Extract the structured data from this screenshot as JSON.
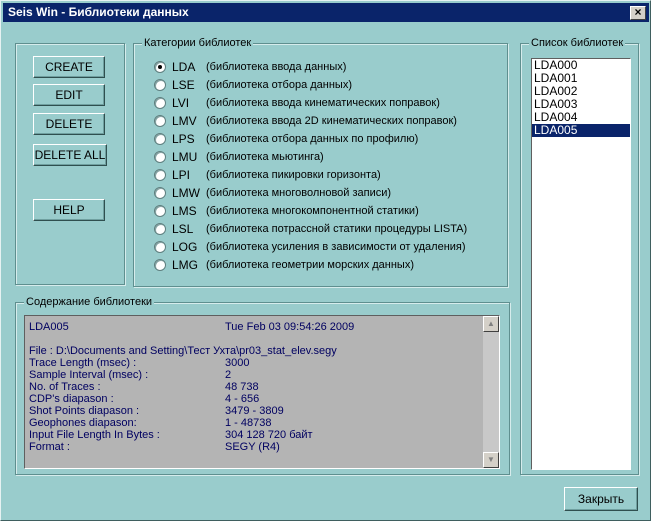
{
  "window": {
    "title": "Seis Win - Библиотеки данных",
    "close_glyph": "×"
  },
  "actions": {
    "create": "CREATE",
    "edit": "EDIT",
    "delete": "DELETE",
    "delete_all": "DELETE ALL",
    "help": "HELP"
  },
  "categories": {
    "title": "Категории библиотек",
    "selected": "LDA",
    "items": [
      {
        "code": "LDA",
        "desc": "(библиотека ввода данных)",
        "checked": true
      },
      {
        "code": "LSE",
        "desc": "(библиотека отбора данных)",
        "checked": false
      },
      {
        "code": "LVI",
        "desc": "(библиотека ввода кинематических поправок)",
        "checked": false
      },
      {
        "code": "LMV",
        "desc": "(библиотека ввода 2D кинематических поправок)",
        "checked": false
      },
      {
        "code": "LPS",
        "desc": "(библиотека отбора данных по профилю)",
        "checked": false
      },
      {
        "code": "LMU",
        "desc": "(библиотека мьютинга)",
        "checked": false
      },
      {
        "code": "LPI",
        "desc": "(библиотека пикировки горизонта)",
        "checked": false
      },
      {
        "code": "LMW",
        "desc": "(библиотека многоволновой записи)",
        "checked": false
      },
      {
        "code": "LMS",
        "desc": "(библиотека многокомпонентной статики)",
        "checked": false
      },
      {
        "code": "LSL",
        "desc": "(библиотека потрассной статики процедуры LISTA)",
        "checked": false
      },
      {
        "code": "LOG",
        "desc": "(библиотека усиления в зависимости от удаления)",
        "checked": false
      },
      {
        "code": "LMG",
        "desc": "(библиотека геометрии морских данных)",
        "checked": false
      }
    ]
  },
  "library_list": {
    "title": "Список библиотек",
    "items": [
      "LDA000",
      "LDA001",
      "LDA002",
      "LDA003",
      "LDA004",
      "LDA005"
    ],
    "selected": "LDA005"
  },
  "content": {
    "title": "Содержание библиотеки",
    "header_name": "LDA005",
    "header_date": "Tue Feb 03 09:54:26 2009",
    "file": "File : D:\\Documents and Setting\\Тест Ухта\\pr03_stat_elev.segy",
    "rows": [
      {
        "key": "Trace Length (msec) :",
        "value": "3000"
      },
      {
        "key": "Sample Interval (msec) :",
        "value": "2"
      },
      {
        "key": "No. of Traces :",
        "value": "48 738"
      },
      {
        "key": "CDP's diapason :",
        "value": "4 - 656"
      },
      {
        "key": "Shot Points  diapason :",
        "value": "3479 - 3809"
      },
      {
        "key": "Geophones diapason:",
        "value": "1 - 48738"
      },
      {
        "key": "Input File Length In Bytes :",
        "value": "304 128 720 байт"
      },
      {
        "key": "Format :",
        "value": "SEGY (R4)"
      }
    ]
  },
  "footer": {
    "close_label": "Закрыть"
  },
  "colors": {
    "window_bg": "#99cccc",
    "titlebar": "#0a246a",
    "content_bg": "#b4b4b4",
    "content_text": "#000060",
    "selection": "#0a246a"
  }
}
